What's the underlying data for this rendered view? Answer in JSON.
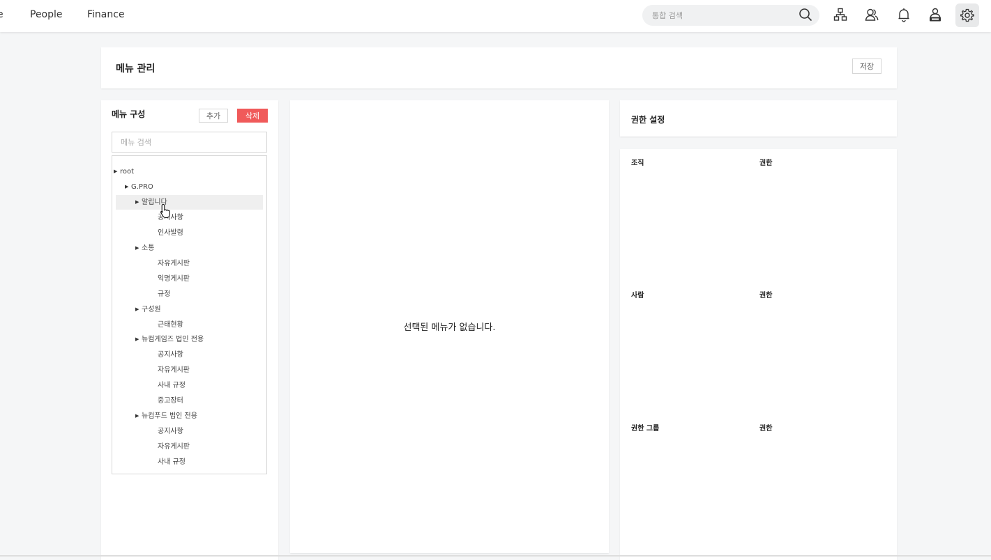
{
  "nav": {
    "cut_item": "e",
    "people": "People",
    "finance": "Finance"
  },
  "search": {
    "placeholder": "통합 검색"
  },
  "icons": {
    "search": "search-icon",
    "org": "org-chart-icon",
    "people": "people-icon",
    "bell": "bell-icon",
    "admin": "admin-user-icon",
    "settings": "gear-icon"
  },
  "header": {
    "title": "메뉴 관리",
    "save_label": "저장"
  },
  "menu_panel": {
    "title": "메뉴 구성",
    "add_label": "추가",
    "delete_label": "삭제",
    "search_placeholder": "메뉴 검색",
    "tree": [
      {
        "label": "root",
        "level": 0,
        "has_children": true
      },
      {
        "label": "G.PRO",
        "level": 1,
        "has_children": true
      },
      {
        "label": "알립니다",
        "level": 2,
        "has_children": true,
        "selected": true
      },
      {
        "label": "공지사항",
        "level": 3,
        "has_children": false
      },
      {
        "label": "인사발령",
        "level": 3,
        "has_children": false
      },
      {
        "label": "소통",
        "level": 2,
        "has_children": true
      },
      {
        "label": "자유게시판",
        "level": 3,
        "has_children": false
      },
      {
        "label": "익명게시판",
        "level": 3,
        "has_children": false
      },
      {
        "label": "규정",
        "level": 3,
        "has_children": false
      },
      {
        "label": "구성원",
        "level": 2,
        "has_children": true
      },
      {
        "label": "근태현황",
        "level": 3,
        "has_children": false
      },
      {
        "label": "뉴컴게임즈 법인 전용",
        "level": 2,
        "has_children": true
      },
      {
        "label": "공지사항",
        "level": 3,
        "has_children": false
      },
      {
        "label": "자유게시판",
        "level": 3,
        "has_children": false
      },
      {
        "label": "사내 규정",
        "level": 3,
        "has_children": false
      },
      {
        "label": "중고장터",
        "level": 3,
        "has_children": false
      },
      {
        "label": "뉴컴푸드 법인 전용",
        "level": 2,
        "has_children": true
      },
      {
        "label": "공지사항",
        "level": 3,
        "has_children": false
      },
      {
        "label": "자유게시판",
        "level": 3,
        "has_children": false
      },
      {
        "label": "사내 규정",
        "level": 3,
        "has_children": false
      }
    ]
  },
  "detail": {
    "empty_message": "선택된 메뉴가 없습니다."
  },
  "permissions": {
    "title": "권한 설정",
    "sections": [
      {
        "label": "조직",
        "perm_label": "권한"
      },
      {
        "label": "사람",
        "perm_label": "권한"
      },
      {
        "label": "권한 그룹",
        "perm_label": "권한"
      }
    ]
  },
  "colors": {
    "delete_button": "#f05a5a",
    "selected_row": "#efefef",
    "page_background": "#f5f6f7"
  }
}
